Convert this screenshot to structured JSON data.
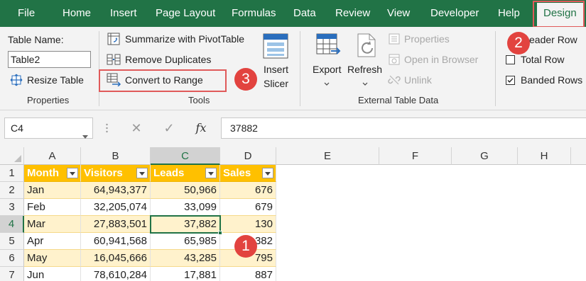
{
  "menu": {
    "tabs": [
      "File",
      "Home",
      "Insert",
      "Page Layout",
      "Formulas",
      "Data",
      "Review",
      "View",
      "Developer",
      "Help",
      "Design"
    ],
    "active_tab": "Design"
  },
  "ribbon": {
    "properties": {
      "table_name_label": "Table Name:",
      "table_name_value": "Table2",
      "resize_label": "Resize Table",
      "group_label": "Properties"
    },
    "tools": {
      "summarize_label": "Summarize with PivotTable",
      "remove_duplicates_label": "Remove Duplicates",
      "convert_label": "Convert to Range",
      "insert_label": "Insert",
      "slicer_label": "Slicer",
      "group_label": "Tools"
    },
    "external": {
      "export_label": "Export",
      "refresh_label": "Refresh",
      "properties_label": "Properties",
      "open_browser_label": "Open in Browser",
      "unlink_label": "Unlink",
      "group_label": "External Table Data"
    },
    "style_options": {
      "header_row_label": "Header Row",
      "header_row_visible": "eader Row",
      "total_row_label": "Total Row",
      "banded_rows_label": "Banded Rows",
      "header_row_checked": true,
      "total_row_checked": false,
      "banded_rows_checked": true
    }
  },
  "callouts": [
    "1",
    "2",
    "3"
  ],
  "formula_bar": {
    "cell_ref": "C4",
    "cancel_symbol": "✕",
    "enter_symbol": "✓",
    "fx_label": "fx",
    "value": "37882"
  },
  "grid": {
    "columns": [
      "A",
      "B",
      "C",
      "D",
      "E",
      "F",
      "G",
      "H"
    ],
    "selected_column": "C",
    "rows": [
      "1",
      "2",
      "3",
      "4",
      "5",
      "6",
      "7"
    ],
    "selected_row": "4",
    "table_headers": [
      "Month",
      "Visitors",
      "Leads",
      "Sales"
    ],
    "table_rows": [
      [
        "Jan",
        "64,943,377",
        "50,966",
        "676"
      ],
      [
        "Feb",
        "32,205,074",
        "33,099",
        "679"
      ],
      [
        "Mar",
        "27,883,501",
        "37,882",
        "130"
      ],
      [
        "Apr",
        "60,941,568",
        "65,985",
        "382"
      ],
      [
        "May",
        "16,045,666",
        "43,285",
        "795"
      ],
      [
        "Jun",
        "78,610,284",
        "17,881",
        "887"
      ]
    ]
  },
  "colors": {
    "excel_green": "#217346",
    "table_header": "#ffc000",
    "table_band": "#fff2cc",
    "callout_red": "#e2433f"
  }
}
